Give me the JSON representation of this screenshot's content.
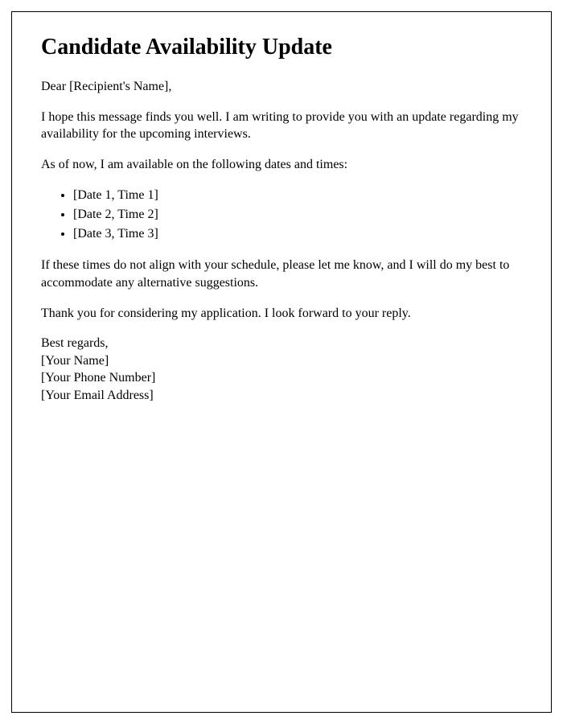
{
  "title": "Candidate Availability Update",
  "greeting": "Dear [Recipient's Name],",
  "paragraph1": "I hope this message finds you well. I am writing to provide you with an update regarding my availability for the upcoming interviews.",
  "paragraph2": "As of now, I am available on the following dates and times:",
  "availability": [
    "[Date 1, Time 1]",
    "[Date 2, Time 2]",
    "[Date 3, Time 3]"
  ],
  "paragraph3": "If these times do not align with your schedule, please let me know, and I will do my best to accommodate any alternative suggestions.",
  "paragraph4": "Thank you for considering my application. I look forward to your reply.",
  "signature": {
    "closing": "Best regards,",
    "name": "[Your Name]",
    "phone": "[Your Phone Number]",
    "email": "[Your Email Address]"
  }
}
